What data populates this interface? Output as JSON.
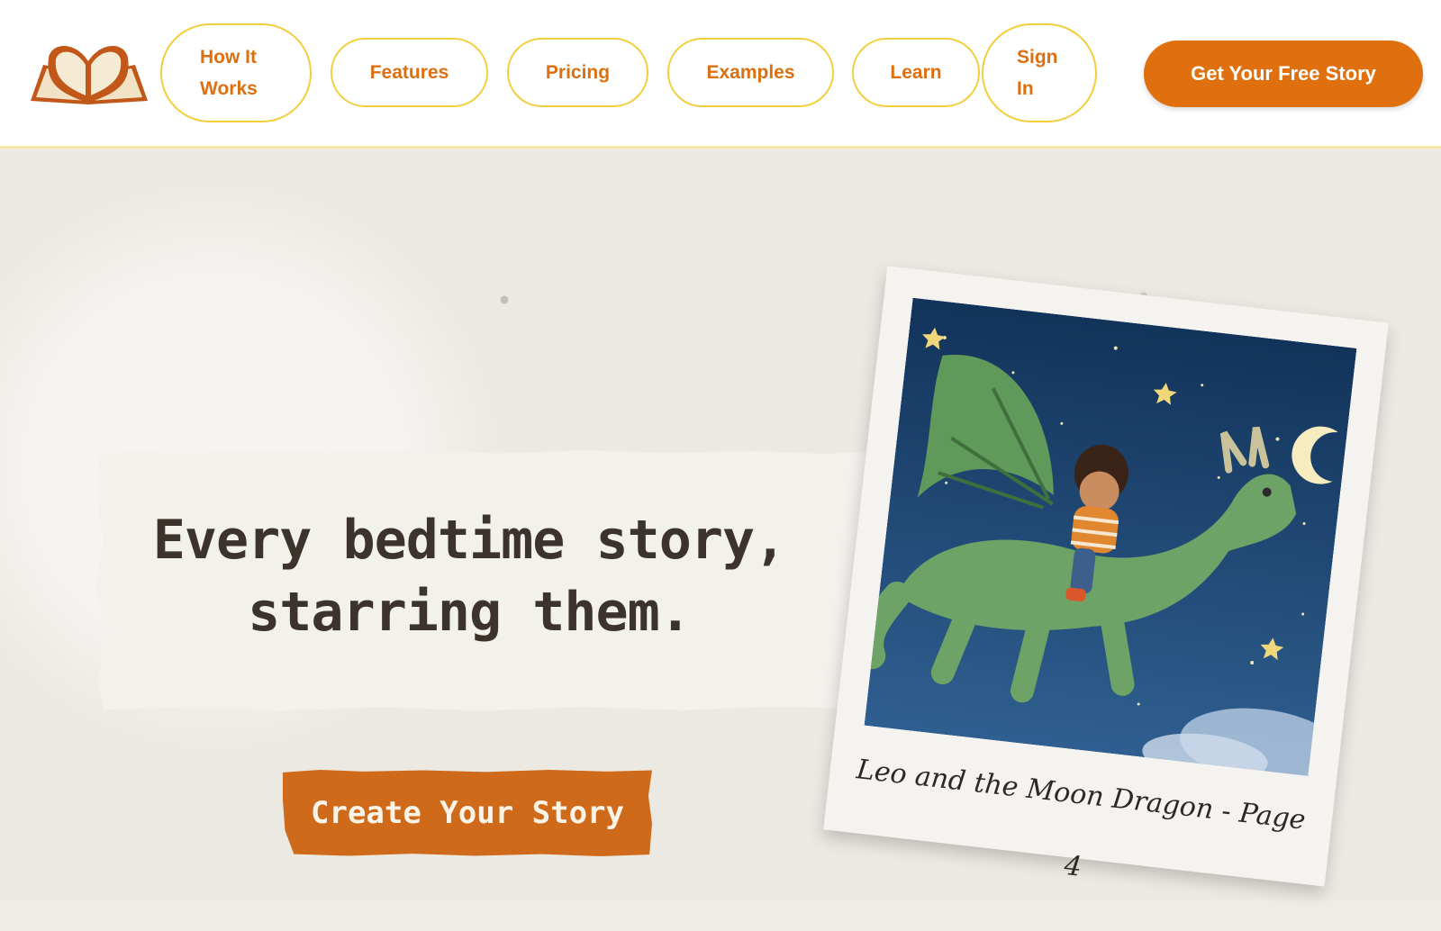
{
  "header": {
    "nav": [
      {
        "label_line1": "How It",
        "label_line2": "Works"
      },
      {
        "label": "Features"
      },
      {
        "label": "Pricing"
      },
      {
        "label": "Examples"
      },
      {
        "label": "Learn"
      },
      {
        "label_line1": "Sign",
        "label_line2": "In"
      }
    ],
    "cta_label": "Get Your Free Story"
  },
  "hero": {
    "headline_line1": "Every bedtime story,",
    "headline_line2": "starring them.",
    "button_label": "Create Your Story",
    "polaroid_caption": "Leo and the Moon Dragon - Page 4"
  },
  "colors": {
    "accent": "#e0700d",
    "nav_border": "#f2cd3c",
    "background": "#ece9e2"
  }
}
